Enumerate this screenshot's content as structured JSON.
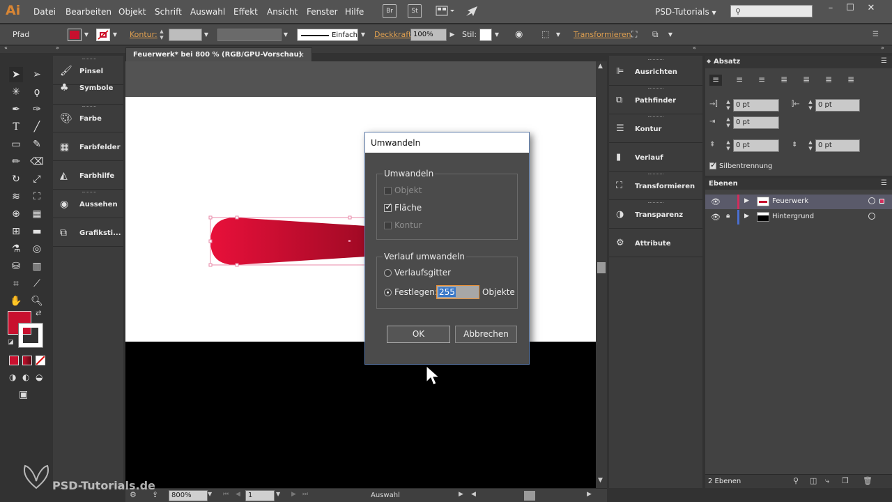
{
  "app": {
    "logo": "Ai",
    "menu": [
      "Datei",
      "Bearbeiten",
      "Objekt",
      "Schrift",
      "Auswahl",
      "Effekt",
      "Ansicht",
      "Fenster",
      "Hilfe"
    ],
    "bridge_label": "Br",
    "stock_label": "St",
    "workspace": "PSD-Tutorials",
    "window_controls": [
      "minimize-icon",
      "maximize-icon",
      "close-icon"
    ]
  },
  "control_bar": {
    "selection_type": "Pfad",
    "stroke_label": "Kontur:",
    "stroke_style": "Einfach",
    "opacity_label": "Deckkraft:",
    "opacity_value": "100%",
    "style_label": "Stil:",
    "transform_link": "Transformieren",
    "fill_color": "#c8102e"
  },
  "document": {
    "tab_title": "Feuerwerk* bei 800 % (RGB/GPU-Vorschau)",
    "close": "×"
  },
  "left_panels": [
    {
      "label": "Pinsel",
      "icon": "brush-icon"
    },
    {
      "label": "Symbole",
      "icon": "symbols-icon"
    },
    {
      "label": "Farbe",
      "icon": "palette-icon"
    },
    {
      "label": "Farbfelder",
      "icon": "swatches-icon"
    },
    {
      "label": "Farbhilfe",
      "icon": "color-guide-icon"
    },
    {
      "label": "Aussehen",
      "icon": "appearance-icon"
    },
    {
      "label": "Grafiksti...",
      "icon": "graphic-styles-icon"
    }
  ],
  "mid_panels": [
    {
      "label": "Ausrichten",
      "icon": "align-icon"
    },
    {
      "label": "Pathfinder",
      "icon": "pathfinder-icon"
    },
    {
      "label": "Kontur",
      "icon": "stroke-icon"
    },
    {
      "label": "Verlauf",
      "icon": "gradient-icon"
    },
    {
      "label": "Transformieren",
      "icon": "transform-icon"
    },
    {
      "label": "Transparenz",
      "icon": "transparency-icon"
    },
    {
      "label": "Attribute",
      "icon": "attributes-icon"
    }
  ],
  "absatz": {
    "title": "Absatz",
    "indent_left": "0 pt",
    "indent_right": "0 pt",
    "indent_first": "0 pt",
    "space_before": "0 pt",
    "space_after": "0 pt",
    "hyphenation_label": "Silbentrennung",
    "hyphenation_checked": true
  },
  "ebenen": {
    "title": "Ebenen",
    "layers": [
      {
        "name": "Feuerwerk",
        "color": "#d12e5c",
        "selected": true
      },
      {
        "name": "Hintergrund",
        "color": "#4a6fd1",
        "selected": false
      }
    ],
    "count_label": "2 Ebenen"
  },
  "status": {
    "zoom": "800%",
    "artboard": "1",
    "tool_label": "Auswahl"
  },
  "dialog": {
    "title": "Umwandeln",
    "group1_label": "Umwandeln",
    "opt_objekt": "Objekt",
    "opt_flaeche": "Fläche",
    "opt_kontur": "Kontur",
    "group2_label": "Verlauf umwandeln",
    "opt_gitter": "Verlaufsgitter",
    "opt_festlegen": "Festlegen:",
    "festlegen_value": "255",
    "objekte_label": "Objekte",
    "ok": "OK",
    "cancel": "Abbrechen"
  },
  "watermark": "PSD-Tutorials.de"
}
